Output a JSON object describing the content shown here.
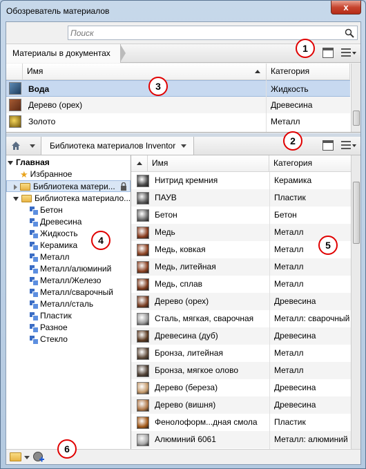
{
  "window": {
    "title": "Обозреватель материалов",
    "close_glyph": "x"
  },
  "search": {
    "placeholder": "Поиск"
  },
  "doc_section": {
    "breadcrumb": "Материалы в документах",
    "columns": {
      "name": "Имя",
      "category": "Категория"
    },
    "rows": [
      {
        "name": "Вода",
        "category": "Жидкость",
        "selected": true,
        "color": "#2a4f76"
      },
      {
        "name": "Дерево (орех)",
        "category": "Древесина",
        "selected": false,
        "color": "#7a3f24"
      },
      {
        "name": "Золото",
        "category": "Металл",
        "selected": false,
        "color": "#b38a1c"
      }
    ]
  },
  "lib_section": {
    "breadcrumb": "Библиотека материалов Inventor",
    "tree": {
      "root": "Главная",
      "favorites": "Избранное",
      "lib1": "Библиотека матери...",
      "lib2": "Библиотека материало...",
      "categories": [
        "Бетон",
        "Древесина",
        "Жидкость",
        "Керамика",
        "Металл",
        "Металл/алюминий",
        "Металл/Железо",
        "Металл/сварочный",
        "Металл/сталь",
        "Пластик",
        "Разное",
        "Стекло"
      ]
    },
    "columns": {
      "name": "Имя",
      "category": "Категория"
    },
    "rows": [
      {
        "name": "Нитрид кремния",
        "category": "Керамика",
        "color": "#4a4a4a"
      },
      {
        "name": "ПАУВ",
        "category": "Пластик",
        "color": "#5b5b5b"
      },
      {
        "name": "Бетон",
        "category": "Бетон",
        "color": "#6b6b6b"
      },
      {
        "name": "Медь",
        "category": "Металл",
        "color": "#8a3d1f"
      },
      {
        "name": "Медь, ковкая",
        "category": "Металл",
        "color": "#8e4424"
      },
      {
        "name": "Медь, литейная",
        "category": "Металл",
        "color": "#8a4122"
      },
      {
        "name": "Медь, сплав",
        "category": "Металл",
        "color": "#7d3a1c"
      },
      {
        "name": "Дерево (орех)",
        "category": "Древесина",
        "color": "#7a3f24"
      },
      {
        "name": "Сталь, мягкая, сварочная",
        "category": "Металл: сварочный",
        "color": "#9a9a9a"
      },
      {
        "name": "Древесина (дуб)",
        "category": "Древесина",
        "color": "#5c3b22"
      },
      {
        "name": "Бронза, литейная",
        "category": "Металл",
        "color": "#5e4a3a"
      },
      {
        "name": "Бронза, мягкое олово",
        "category": "Металл",
        "color": "#514236"
      },
      {
        "name": "Дерево (береза)",
        "category": "Древесина",
        "color": "#c49a6c"
      },
      {
        "name": "Дерево (вишня)",
        "category": "Древесина",
        "color": "#b07848"
      },
      {
        "name": "Фенолоформ...дная смола",
        "category": "Пластик",
        "color": "#a35a1a"
      },
      {
        "name": "Алюминий 6061",
        "category": "Металл: алюминий",
        "color": "#a9a9a9"
      }
    ]
  },
  "callouts": [
    "1",
    "2",
    "3",
    "4",
    "5",
    "6"
  ],
  "colors": {
    "selection": "#c7d9f0",
    "accent": "#e00000"
  }
}
